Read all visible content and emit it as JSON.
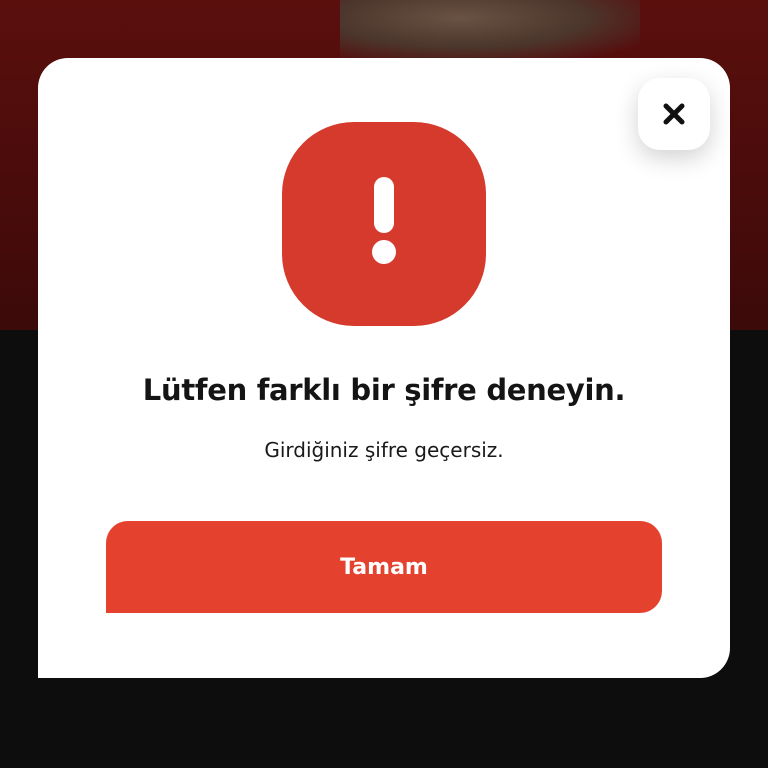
{
  "dialog": {
    "title": "Lütfen farklı bir şifre deneyin.",
    "message": "Girdiğiniz şifre geçersiz.",
    "confirm_label": "Tamam",
    "close_icon": "close-icon",
    "alert_icon": "exclamation-icon"
  },
  "colors": {
    "alert_badge": "#d53a2c",
    "confirm_button": "#e5412f",
    "dialog_background": "#ffffff",
    "backdrop": "#0d0d0d"
  }
}
